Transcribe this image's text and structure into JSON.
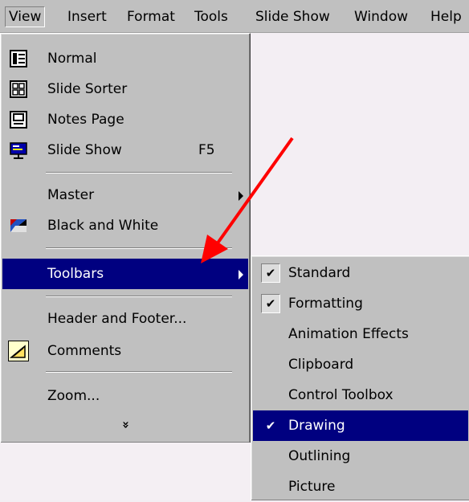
{
  "menubar": {
    "items": [
      {
        "label": "View"
      },
      {
        "label": "Insert"
      },
      {
        "label": "Format"
      },
      {
        "label": "Tools"
      },
      {
        "label": "Slide Show"
      },
      {
        "label": "Window"
      },
      {
        "label": "Help"
      }
    ]
  },
  "view_menu": {
    "items": [
      {
        "label": "Normal",
        "icon": "normal-view-icon"
      },
      {
        "label": "Slide Sorter",
        "icon": "slide-sorter-icon"
      },
      {
        "label": "Notes Page",
        "icon": "notes-page-icon"
      },
      {
        "label": "Slide Show",
        "icon": "slide-show-icon",
        "shortcut": "F5"
      },
      {
        "label": "Master",
        "has_submenu": true
      },
      {
        "label": "Black and White",
        "icon": "black-and-white-icon"
      },
      {
        "label": "Toolbars",
        "has_submenu": true,
        "selected": true
      },
      {
        "label": "Header and Footer..."
      },
      {
        "label": "Comments",
        "icon": "comments-icon"
      },
      {
        "label": "Zoom..."
      }
    ],
    "expand_label": "»"
  },
  "toolbars_submenu": {
    "items": [
      {
        "label": "Standard",
        "checked": true
      },
      {
        "label": "Formatting",
        "checked": true
      },
      {
        "label": "Animation Effects",
        "checked": false
      },
      {
        "label": "Clipboard",
        "checked": false
      },
      {
        "label": "Control Toolbox",
        "checked": false
      },
      {
        "label": "Drawing",
        "checked": true,
        "selected": true
      },
      {
        "label": "Outlining",
        "checked": false
      },
      {
        "label": "Picture",
        "checked": false
      }
    ],
    "check_glyph": "✔"
  },
  "colors": {
    "menu_bg": "#c0c0c0",
    "highlight": "#000080",
    "annotation_arrow": "#ff0000"
  }
}
